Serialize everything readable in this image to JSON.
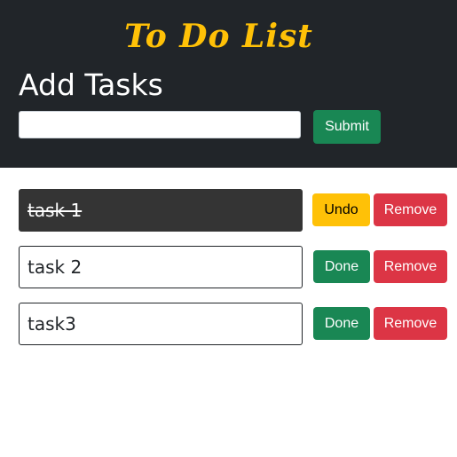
{
  "header": {
    "app_title": "To Do List",
    "section_heading": "Add Tasks",
    "input_value": "",
    "submit_label": "Submit"
  },
  "tasks": [
    {
      "text": "task 1",
      "completed": true,
      "action_label": "Undo",
      "remove_label": "Remove"
    },
    {
      "text": "task 2",
      "completed": false,
      "action_label": "Done",
      "remove_label": "Remove"
    },
    {
      "text": "task3",
      "completed": false,
      "action_label": "Done",
      "remove_label": "Remove"
    }
  ],
  "colors": {
    "header_bg": "#212529",
    "title": "#ffc107",
    "success": "#198754",
    "danger": "#dc3545",
    "warning": "#ffc107",
    "completed_task_bg": "#343434"
  }
}
